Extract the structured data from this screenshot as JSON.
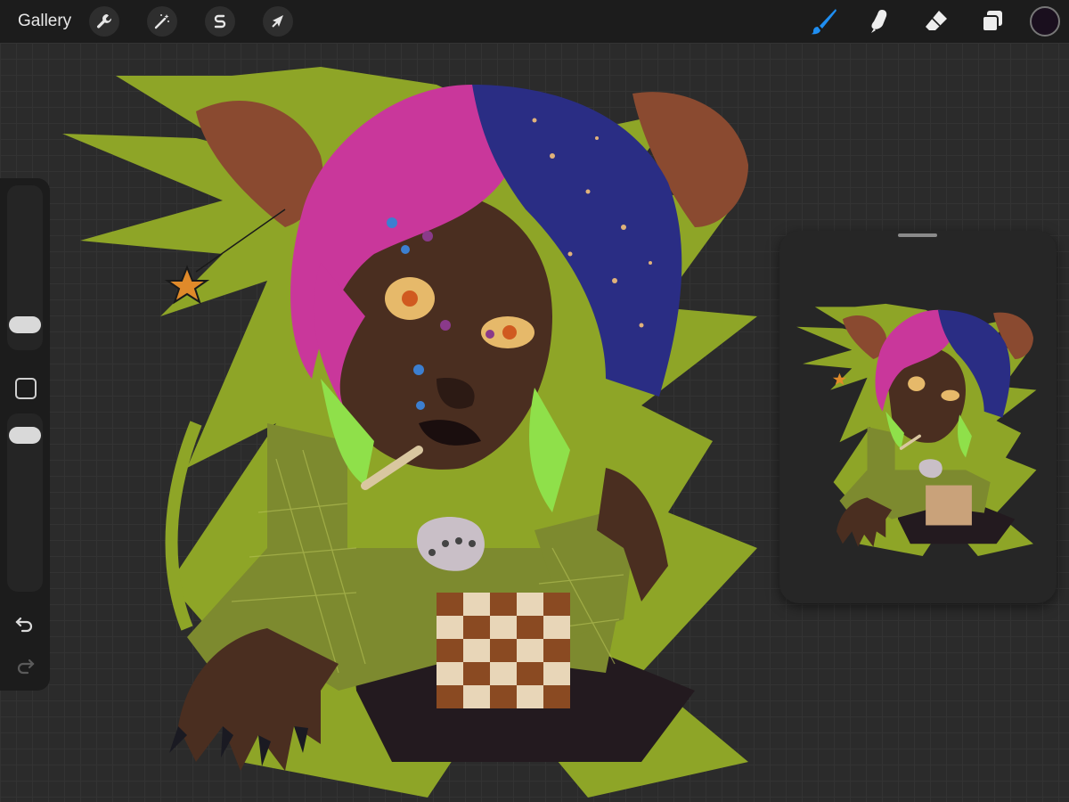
{
  "topbar": {
    "gallery_label": "Gallery",
    "left_tools": [
      "wrench-icon",
      "magic-wand-icon",
      "selection-s-icon",
      "arrow-transform-icon"
    ],
    "right_tools": [
      "brush-icon",
      "smudge-icon",
      "eraser-icon",
      "layers-icon"
    ],
    "active_tool": "brush-icon",
    "current_color": "#1a0f1e",
    "accent_color": "#1f8ef1"
  },
  "sidebar": {
    "controls": [
      "brush-size-slider",
      "modify-button",
      "opacity-slider",
      "undo-icon",
      "redo-icon"
    ]
  },
  "canvas": {
    "artwork_description_colors": {
      "background_splash": "#8ea527",
      "hair_pink": "#c9379b",
      "hair_blue": "#2a2d84",
      "skin": "#4a2e20",
      "sweater": "#7d8a2f"
    }
  },
  "reference": {
    "window": "reference-companion"
  }
}
